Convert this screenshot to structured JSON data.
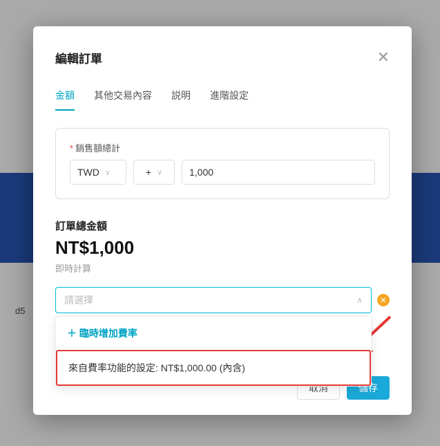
{
  "backdrop": {
    "truncated": "d5"
  },
  "modal": {
    "title": "編輯訂單",
    "tabs": [
      "金額",
      "其他交易內容",
      "説明",
      "進階設定"
    ],
    "activeTabIndex": 0,
    "salesField": {
      "requiredMark": "*",
      "label": "銷售額總計",
      "currency": "TWD",
      "operator": "+",
      "value": "1,000"
    },
    "summary": {
      "label": "訂單總金額",
      "amount": "NT$1,000",
      "sub": "即時計算"
    },
    "dropdown": {
      "placeholder": "請選擇",
      "addLabel": "＋ 臨時增加費率",
      "option": "來自費率功能的設定: NT$1,000.00 (內含)"
    },
    "actions": {
      "cancel": "取消",
      "save": "儲存"
    }
  }
}
